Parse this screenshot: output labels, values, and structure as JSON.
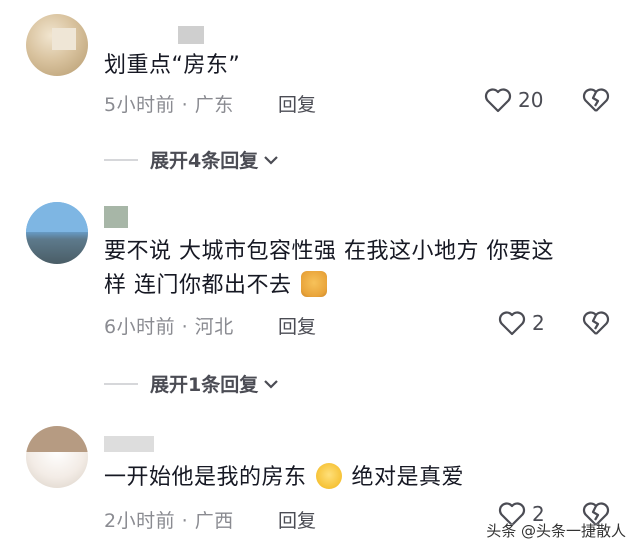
{
  "comments": [
    {
      "text": "划重点“房东”",
      "time": "5小时前",
      "location": "广东",
      "reply_label": "回复",
      "likes": "20",
      "expand_label": "展开4条回复"
    },
    {
      "text_line1": "要不说 大城市包容性强 在我这小地方 你要这",
      "text_line2": "样 连门你都出不去",
      "time": "6小时前",
      "location": "河北",
      "reply_label": "回复",
      "likes": "2",
      "expand_label": "展开1条回复"
    },
    {
      "text_part1": "一开始他是我的房东",
      "text_part2": "绝对是真爱",
      "time": "2小时前",
      "location": "广西",
      "reply_label": "回复",
      "likes": "2"
    }
  ],
  "separator": "·",
  "watermark": "头条 @头条一捷散人"
}
